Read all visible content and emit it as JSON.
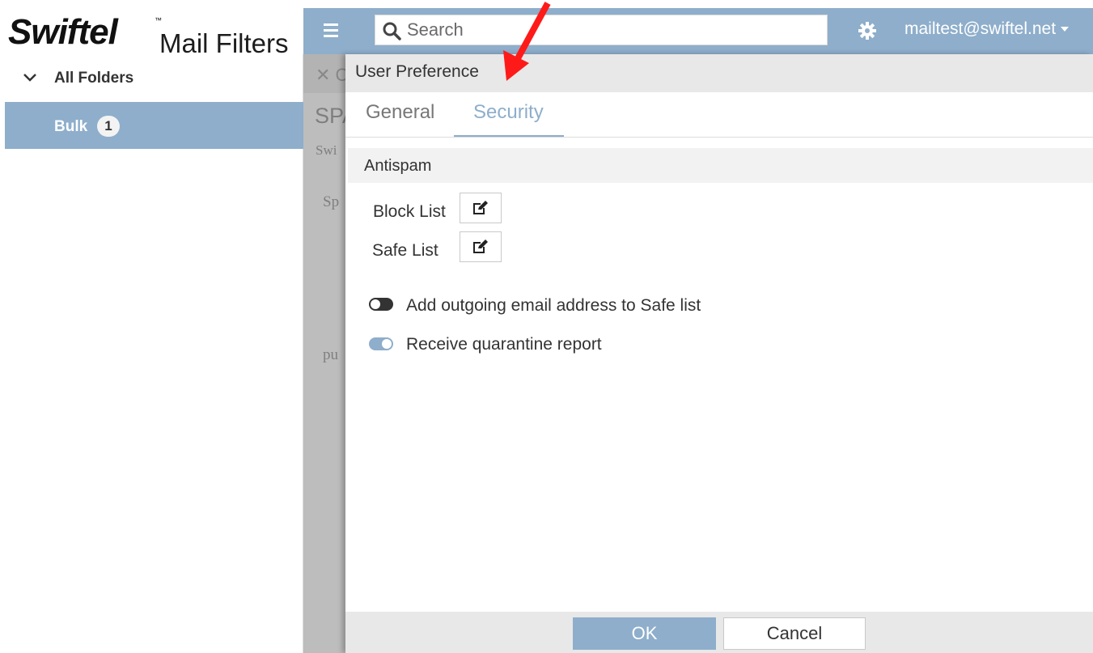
{
  "brand": {
    "logo_text": "Swiftel",
    "trademark": "™",
    "product_name": "Mail Filters"
  },
  "header": {
    "search_placeholder": "Search",
    "user_email": "mailtest@swiftel.net",
    "accent_color": "#8eaecb"
  },
  "sidebar": {
    "all_folders_label": "All Folders",
    "folders": [
      {
        "label": "Bulk",
        "count": "1",
        "selected": true
      }
    ]
  },
  "background": {
    "close_text": "✕ C",
    "title_fragment": "SPA",
    "sub_fragment": "Swi",
    "line_fragment_1": "Sp",
    "line_fragment_2": "pu"
  },
  "modal": {
    "title": "User Preference",
    "tabs": [
      {
        "label": "General",
        "active": false
      },
      {
        "label": "Security",
        "active": true
      }
    ],
    "section_title": "Antispam",
    "lists": [
      {
        "label": "Block List",
        "icon": "edit-icon"
      },
      {
        "label": "Safe List",
        "icon": "edit-icon"
      }
    ],
    "toggles": [
      {
        "label": "Add outgoing email address to Safe list",
        "enabled": false
      },
      {
        "label": "Receive quarantine report",
        "enabled": true
      }
    ],
    "ok_label": "OK",
    "cancel_label": "Cancel"
  }
}
